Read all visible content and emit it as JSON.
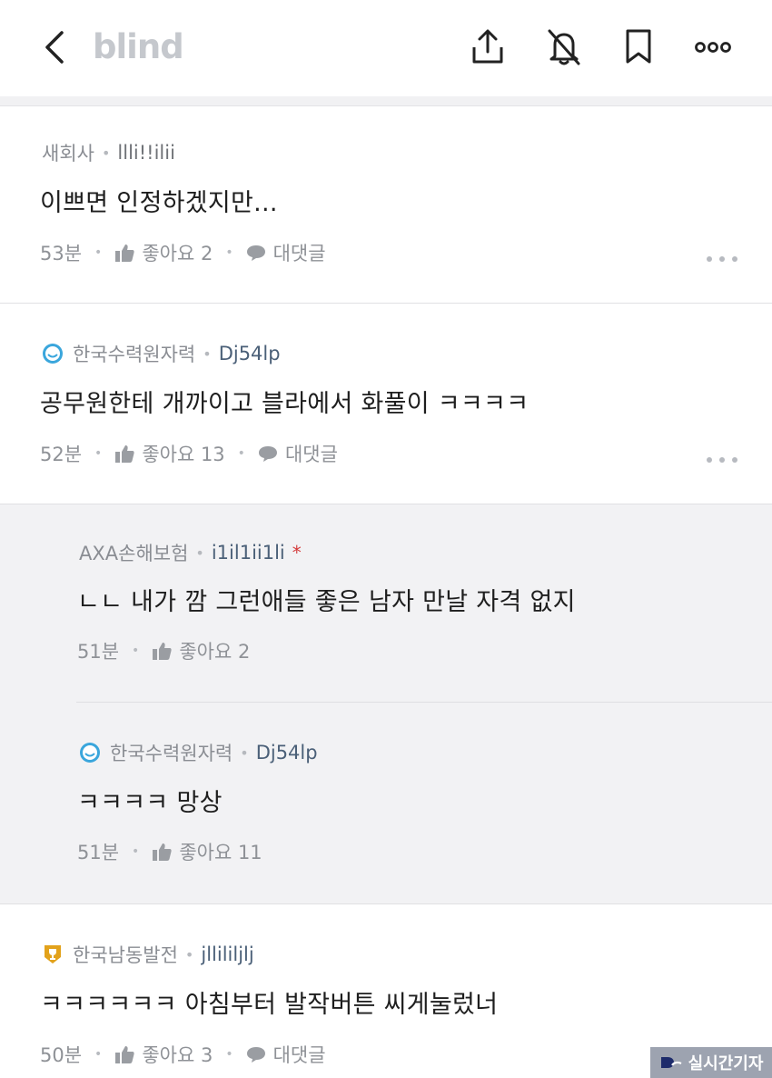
{
  "header": {
    "logo": "blind",
    "icons": [
      "back-arrow-icon",
      "share-icon",
      "bell-off-icon",
      "bookmark-icon",
      "more-icon"
    ]
  },
  "comments": [
    {
      "company": "새회사",
      "nickname": "llli!!ilii",
      "text": "이쁘면 인정하겠지만...",
      "time": "53분",
      "likes": "좋아요 2",
      "reply_label": "대댓글"
    },
    {
      "company": "한국수력원자력",
      "nickname": "Dj54lp",
      "text": "공무원한테 개까이고 블라에서 화풀이 ㅋㅋㅋㅋ",
      "time": "52분",
      "likes": "좋아요 13",
      "reply_label": "대댓글"
    },
    {
      "company": "AXA손해보험",
      "nickname": "i1il1ii1li",
      "author_mark": "*",
      "text": "ㄴㄴ 내가 깜 그런애들 좋은 남자 만날 자격 없지",
      "time": "51분",
      "likes": "좋아요 2"
    },
    {
      "company": "한국수력원자력",
      "nickname": "Dj54lp",
      "text": "ㅋㅋㅋㅋ 망상",
      "time": "51분",
      "likes": "좋아요 11"
    },
    {
      "company": "한국남동발전",
      "nickname": "jllililjlj",
      "text": "ㅋㅋㅋㅋㅋㅋ 아침부터 발작버튼 씨게눌렀너",
      "time": "50분",
      "likes": "좋아요 3",
      "reply_label": "대댓글"
    }
  ],
  "watermark": "실시간기자",
  "colors": {
    "reply_background": "#f2f2f4",
    "meta_gray": "#8a8d93",
    "author_star": "#d43a3a",
    "badge_blue": "#3aa6dc",
    "badge_gold": "#e2a21b"
  }
}
